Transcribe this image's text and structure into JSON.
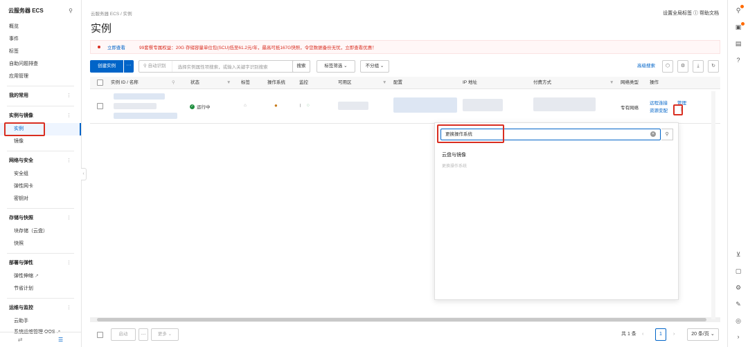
{
  "sidebar": {
    "title": "云服务器 ECS",
    "items": [
      "概览",
      "事件",
      "标签",
      "自助问题排查",
      "应用管理"
    ],
    "favorites": "我的常用",
    "groups": [
      {
        "label": "实例与镜像",
        "children": [
          "实例",
          "镜像"
        ]
      },
      {
        "label": "网络与安全",
        "children": [
          "安全组",
          "弹性网卡",
          "密钥对"
        ]
      },
      {
        "label": "存储与快照",
        "children": [
          "块存储（云盘）",
          "快照"
        ]
      },
      {
        "label": "部署与弹性",
        "children": [
          "弹性伸缩",
          "节省计划"
        ]
      },
      {
        "label": "运维与监控",
        "children": [
          "云助手",
          "系统运维管理 OOS"
        ]
      }
    ]
  },
  "header": {
    "breadcrumb": "云服务器 ECS  /  实例",
    "title": "实例",
    "links": "设置全局标签  ⓘ 帮助文档"
  },
  "notice": {
    "link": "立即查看",
    "text": "99套餐专属权益：20G 存储容量单位包(SCU)低至61.2元/年，最高可抵167G快照，令您数据备份无忧，立即查看优惠！"
  },
  "toolbar": {
    "create": "创建实例",
    "search_prefix": "自动识别",
    "search_placeholder": "选择实例属性项搜索，或输入关键字识别搜索",
    "search_btn": "搜索",
    "tag_filter": "标签筛选",
    "group": "不分组",
    "advanced": "高级搜索"
  },
  "table": {
    "columns": [
      "实例 ID / 名称",
      "状态",
      "标签",
      "操作系统",
      "监控",
      "可用区",
      "配置",
      "IP 地址",
      "付费方式",
      "网络类型",
      "操作"
    ],
    "row": {
      "status": "运行中",
      "network": "专有网络",
      "op_remote": "远程连接",
      "op_manage": "管理",
      "op_resource": "资源变配"
    }
  },
  "popup": {
    "input_value": "更换操作系统",
    "group": "云盘与镜像",
    "item": "更换操作系统"
  },
  "footer": {
    "start": "启动",
    "more": "更多",
    "total": "共 1 条",
    "page": "1",
    "page_size": "20 条/页"
  }
}
